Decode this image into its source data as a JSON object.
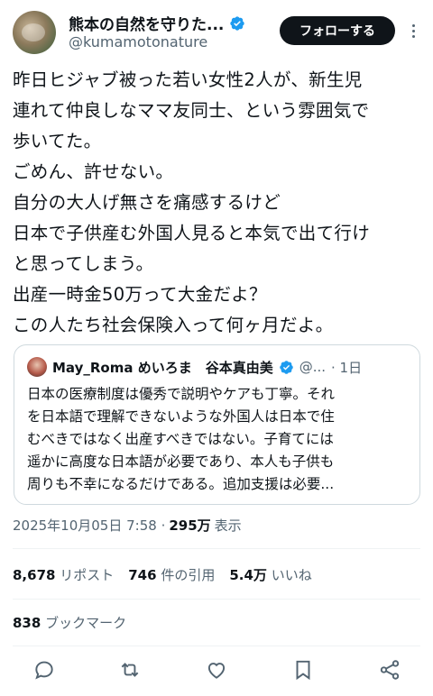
{
  "author": {
    "display_name": "熊本の自然を守りた...",
    "handle": "@kumamotonature",
    "verified_icon": "verified-badge-icon",
    "follow_label": "フォローする",
    "more_icon": "more-icon"
  },
  "tweet": {
    "lines": [
      "昨日ヒジャブ被った若い女性2人が、新生児",
      "連れて仲良しなママ友同士、という雰囲気で",
      "歩いてた。",
      "ごめん、許せない。",
      "自分の大人げ無さを痛感するけど",
      "日本で子供産む外国人見ると本気で出て行け",
      "と思ってしまう。",
      "出産一時金50万って大金だよ？",
      "この人たち社会保険入って何ヶ月だよ。"
    ]
  },
  "quote": {
    "name": "May_Roma めいろま　谷本真由美",
    "handle": "@...",
    "time": "· 1日",
    "lines": [
      "日本の医療制度は優秀で説明やケアも丁寧。それ",
      "を日本語で理解できないような外国人は日本で住",
      "むべきではなく出産すべきではない。子育てには",
      "遥かに高度な日本語が必要であり、本人も子供も",
      "周りも不幸になるだけである。追加支援は必要..."
    ]
  },
  "meta": {
    "timestamp": "2025年10月05日 7:58 ·",
    "views": "295万",
    "views_label": "表示"
  },
  "stats": {
    "reposts": "8,678",
    "reposts_label": "リポスト",
    "quotes": "746",
    "quotes_label": "件の引用",
    "likes": "5.4万",
    "likes_label": "いいね",
    "bookmarks": "838",
    "bookmarks_label": "ブックマーク"
  },
  "actions": [
    "reply-icon",
    "repost-icon",
    "like-icon",
    "bookmark-icon",
    "share-icon"
  ],
  "colors": {
    "text": "#0f1419",
    "secondary": "#536471",
    "verified": "#1d9bf0",
    "follow_bg": "#0f1419",
    "border": "#cfd9de"
  }
}
